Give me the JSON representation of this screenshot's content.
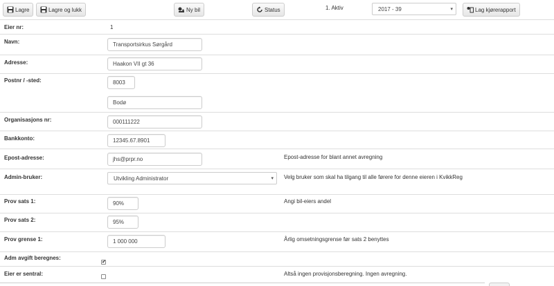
{
  "toolbar": {
    "save_label": "Lagre",
    "save_close_label": "Lagre og lukk",
    "new_car_label": "Ny bil",
    "status_label": "Status",
    "status_text": "1. Aktiv",
    "period_value": "2017 - 39",
    "report_label": "Lag kjørerapport"
  },
  "form": {
    "owner_nr": {
      "label": "Eier nr:",
      "value": "1"
    },
    "name": {
      "label": "Navn:",
      "value": "Transportsirkus Sørgård"
    },
    "address": {
      "label": "Adresse:",
      "value": "Haakon VII gt 36"
    },
    "postal": {
      "label": "Postnr / -sted:",
      "zip": "8003",
      "city": "Bodø"
    },
    "org_nr": {
      "label": "Organisasjons nr:",
      "value": "000111222"
    },
    "bank": {
      "label": "Bankkonto:",
      "value": "12345.67.8901"
    },
    "email": {
      "label": "Epost-adresse:",
      "value": "jhs@prpr.no",
      "help": "Epost-adresse for blant annet avregning"
    },
    "admin_user": {
      "label": "Admin-bruker:",
      "value": "Utvikling Administrator",
      "help": "Velg bruker som skal ha tilgang til alle førere for denne eieren i KvikkReg"
    },
    "prov_rate_1": {
      "label": "Prov sats 1:",
      "value": "90%",
      "help": "Angi bil-eiers andel"
    },
    "prov_rate_2": {
      "label": "Prov sats 2:",
      "value": "95%"
    },
    "prov_limit_1": {
      "label": "Prov grense 1:",
      "value": "1 000 000",
      "help": "Årlig omsetningsgrense før sats 2 benyttes"
    },
    "adm_fee": {
      "label": "Adm avgift beregnes:",
      "checked": true,
      "mark": "✔"
    },
    "is_central": {
      "label": "Eier er sentral:",
      "checked": false,
      "help": "Altså ingen provisjonsberegning. Ingen avregning."
    }
  }
}
